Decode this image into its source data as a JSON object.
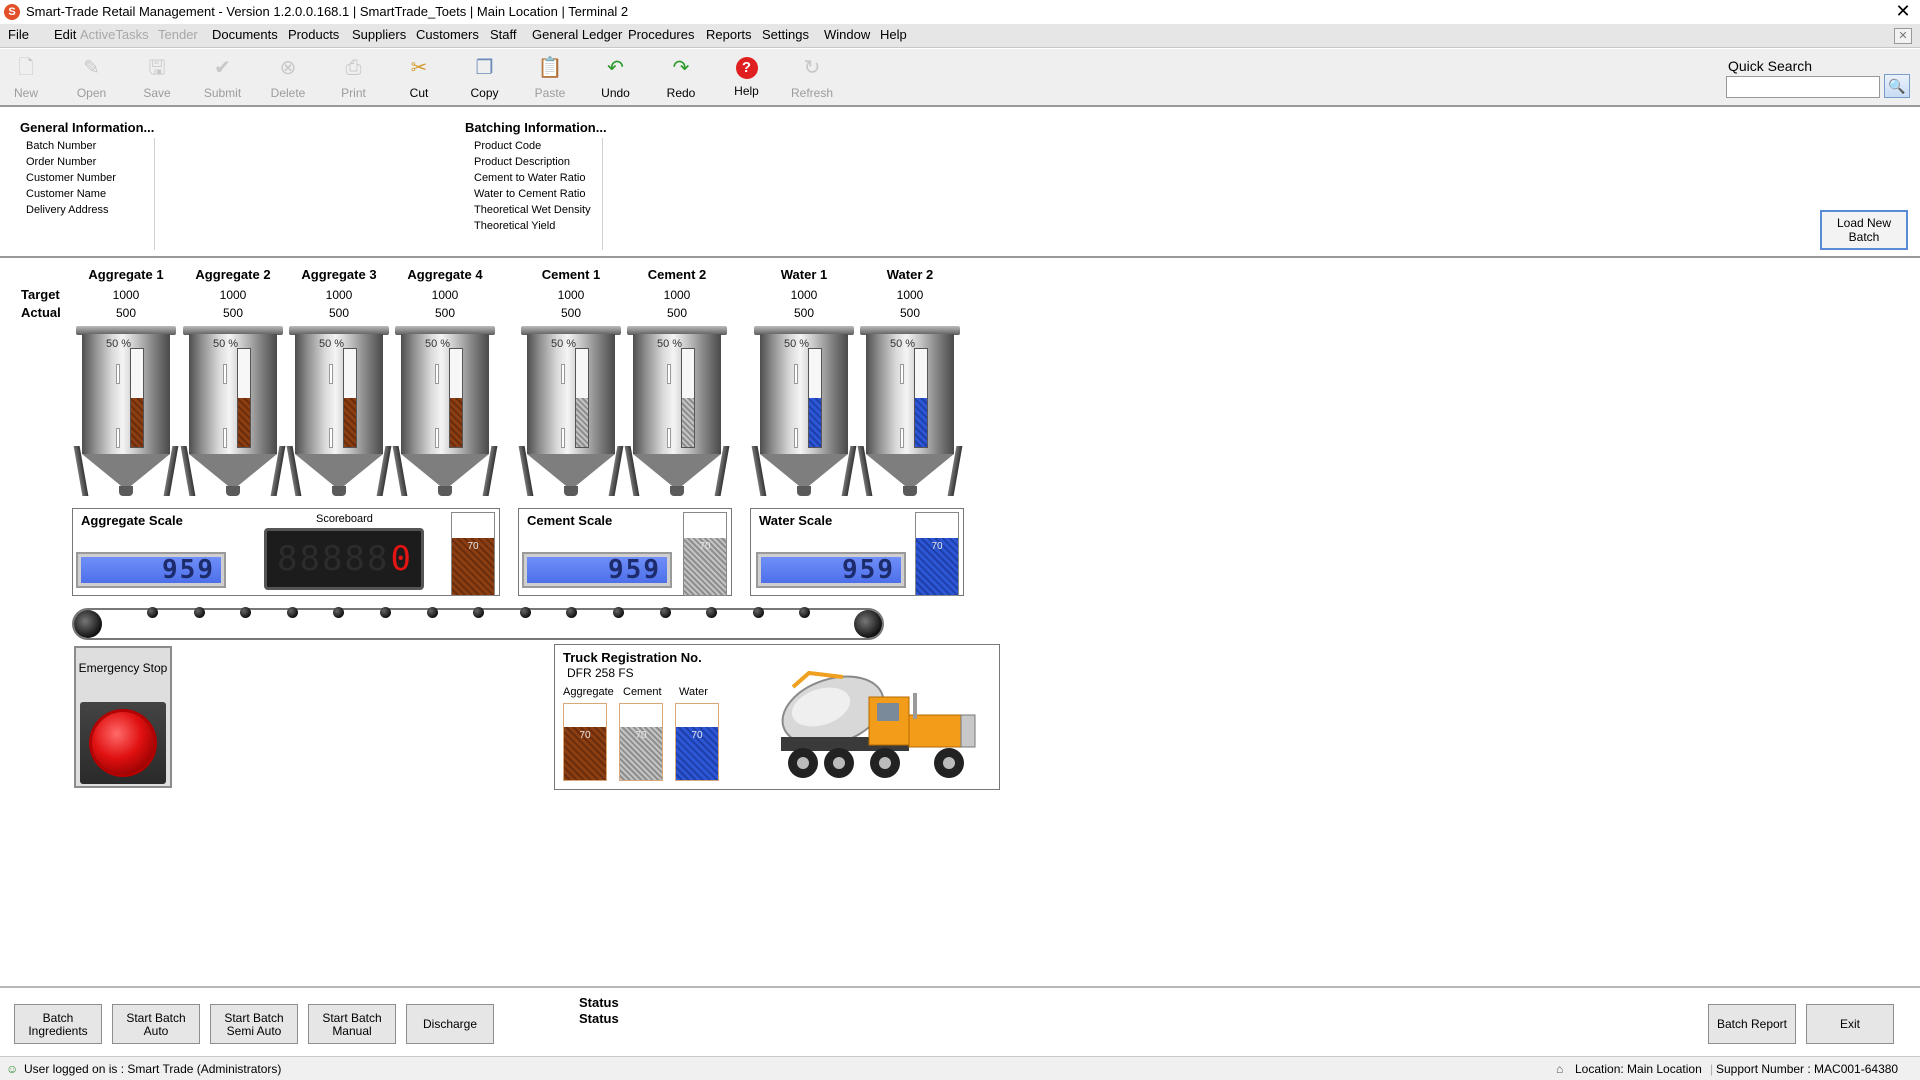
{
  "window": {
    "title": "Smart-Trade Retail Management - Version 1.2.0.0.168.1 | SmartTrade_Toets | Main Location | Terminal 2",
    "close_glyph": "✕"
  },
  "menu": [
    {
      "label": "File",
      "enabled": true
    },
    {
      "label": "Edit",
      "enabled": true
    },
    {
      "label": "ActiveTasks",
      "enabled": false
    },
    {
      "label": "Tender",
      "enabled": false
    },
    {
      "label": "Documents",
      "enabled": true
    },
    {
      "label": "Products",
      "enabled": true
    },
    {
      "label": "Suppliers",
      "enabled": true
    },
    {
      "label": "Customers",
      "enabled": true
    },
    {
      "label": "Staff",
      "enabled": true
    },
    {
      "label": "General Ledger",
      "enabled": true
    },
    {
      "label": "Procedures",
      "enabled": true
    },
    {
      "label": "Reports",
      "enabled": true
    },
    {
      "label": "Settings",
      "enabled": true
    },
    {
      "label": "Window",
      "enabled": true
    },
    {
      "label": "Help",
      "enabled": true
    }
  ],
  "toolbar": [
    {
      "label": "New",
      "icon": "new-document-icon",
      "enabled": false
    },
    {
      "label": "Open",
      "icon": "open-icon",
      "enabled": false
    },
    {
      "label": "Save",
      "icon": "save-icon",
      "enabled": false
    },
    {
      "label": "Submit",
      "icon": "checkmark-icon",
      "enabled": false
    },
    {
      "label": "Delete",
      "icon": "delete-icon",
      "enabled": false
    },
    {
      "label": "Print",
      "icon": "printer-icon",
      "enabled": false
    },
    {
      "label": "Cut",
      "icon": "scissors-icon",
      "enabled": true
    },
    {
      "label": "Copy",
      "icon": "copy-icon",
      "enabled": true
    },
    {
      "label": "Paste",
      "icon": "paste-icon",
      "enabled": false
    },
    {
      "label": "Undo",
      "icon": "undo-arrow-icon",
      "enabled": true
    },
    {
      "label": "Redo",
      "icon": "redo-arrow-icon",
      "enabled": true
    },
    {
      "label": "Help",
      "icon": "help-icon",
      "enabled": true
    },
    {
      "label": "Refresh",
      "icon": "refresh-icon",
      "enabled": false
    }
  ],
  "quick_search": {
    "label": "Quick Search",
    "value": "",
    "placeholder": ""
  },
  "general_info": {
    "heading": "General Information...",
    "fields": [
      "Batch Number",
      "Order Number",
      "Customer Number",
      "Customer Name",
      "Delivery Address"
    ]
  },
  "batching_info": {
    "heading": "Batching Information...",
    "fields": [
      "Product Code",
      "Product Description",
      "Cement to Water Ratio",
      "Water to Cement Ratio",
      "Theoretical Wet Density",
      "Theoretical Yield"
    ]
  },
  "load_new_batch_label": "Load New Batch",
  "row_labels": {
    "target": "Target",
    "actual": "Actual"
  },
  "silos": [
    {
      "name": "Aggregate 1",
      "target": "1000",
      "actual": "500",
      "percent_label": "50 %",
      "level": 0.5,
      "material": "aggregate"
    },
    {
      "name": "Aggregate 2",
      "target": "1000",
      "actual": "500",
      "percent_label": "50 %",
      "level": 0.5,
      "material": "aggregate"
    },
    {
      "name": "Aggregate 3",
      "target": "1000",
      "actual": "500",
      "percent_label": "50 %",
      "level": 0.5,
      "material": "aggregate"
    },
    {
      "name": "Aggregate 4",
      "target": "1000",
      "actual": "500",
      "percent_label": "50 %",
      "level": 0.5,
      "material": "aggregate"
    },
    {
      "name": "Cement 1",
      "target": "1000",
      "actual": "500",
      "percent_label": "50 %",
      "level": 0.5,
      "material": "cement"
    },
    {
      "name": "Cement 2",
      "target": "1000",
      "actual": "500",
      "percent_label": "50 %",
      "level": 0.5,
      "material": "cement"
    },
    {
      "name": "Water 1",
      "target": "1000",
      "actual": "500",
      "percent_label": "50 %",
      "level": 0.5,
      "material": "water"
    },
    {
      "name": "Water 2",
      "target": "1000",
      "actual": "500",
      "percent_label": "50 %",
      "level": 0.5,
      "material": "water"
    }
  ],
  "scales": {
    "aggregate": {
      "title": "Aggregate Scale",
      "reading": "959",
      "level_label": "70",
      "level": 0.7
    },
    "cement": {
      "title": "Cement Scale",
      "reading": "959",
      "level_label": "70",
      "level": 0.7
    },
    "water": {
      "title": "Water Scale",
      "reading": "959",
      "level_label": "70",
      "level": 0.7
    }
  },
  "scoreboard": {
    "label": "Scoreboard",
    "ghost_digits": "88888",
    "value": "0"
  },
  "emergency_stop_label": "Emergency Stop",
  "truck": {
    "reg_label": "Truck Registration No.",
    "reg_value": "DFR 258 FS",
    "loads": [
      {
        "label": "Aggregate",
        "value": "70",
        "level": 0.7,
        "material": "aggregate"
      },
      {
        "label": "Cement",
        "value": "70",
        "level": 0.7,
        "material": "cement"
      },
      {
        "label": "Water",
        "value": "70",
        "level": 0.7,
        "material": "water"
      }
    ]
  },
  "actions": {
    "batch_ingredients": "Batch Ingredients",
    "start_batch_auto": "Start Batch Auto",
    "start_batch_semi_auto": "Start Batch Semi Auto",
    "start_batch_manual": "Start Batch Manual",
    "discharge": "Discharge",
    "batch_report": "Batch Report",
    "exit": "Exit"
  },
  "status_labels": [
    "Status",
    "Status"
  ],
  "status_bar": {
    "user": "User logged on is : Smart Trade (Administrators)",
    "location": "Location: Main Location",
    "support": "Support Number : MAC001-64380"
  },
  "colors": {
    "aggregate": "#8b3e12",
    "cement": "#a8a8a8",
    "water": "#2c56d6",
    "estop": "#e01010",
    "lcd": "#5b7cf0"
  }
}
